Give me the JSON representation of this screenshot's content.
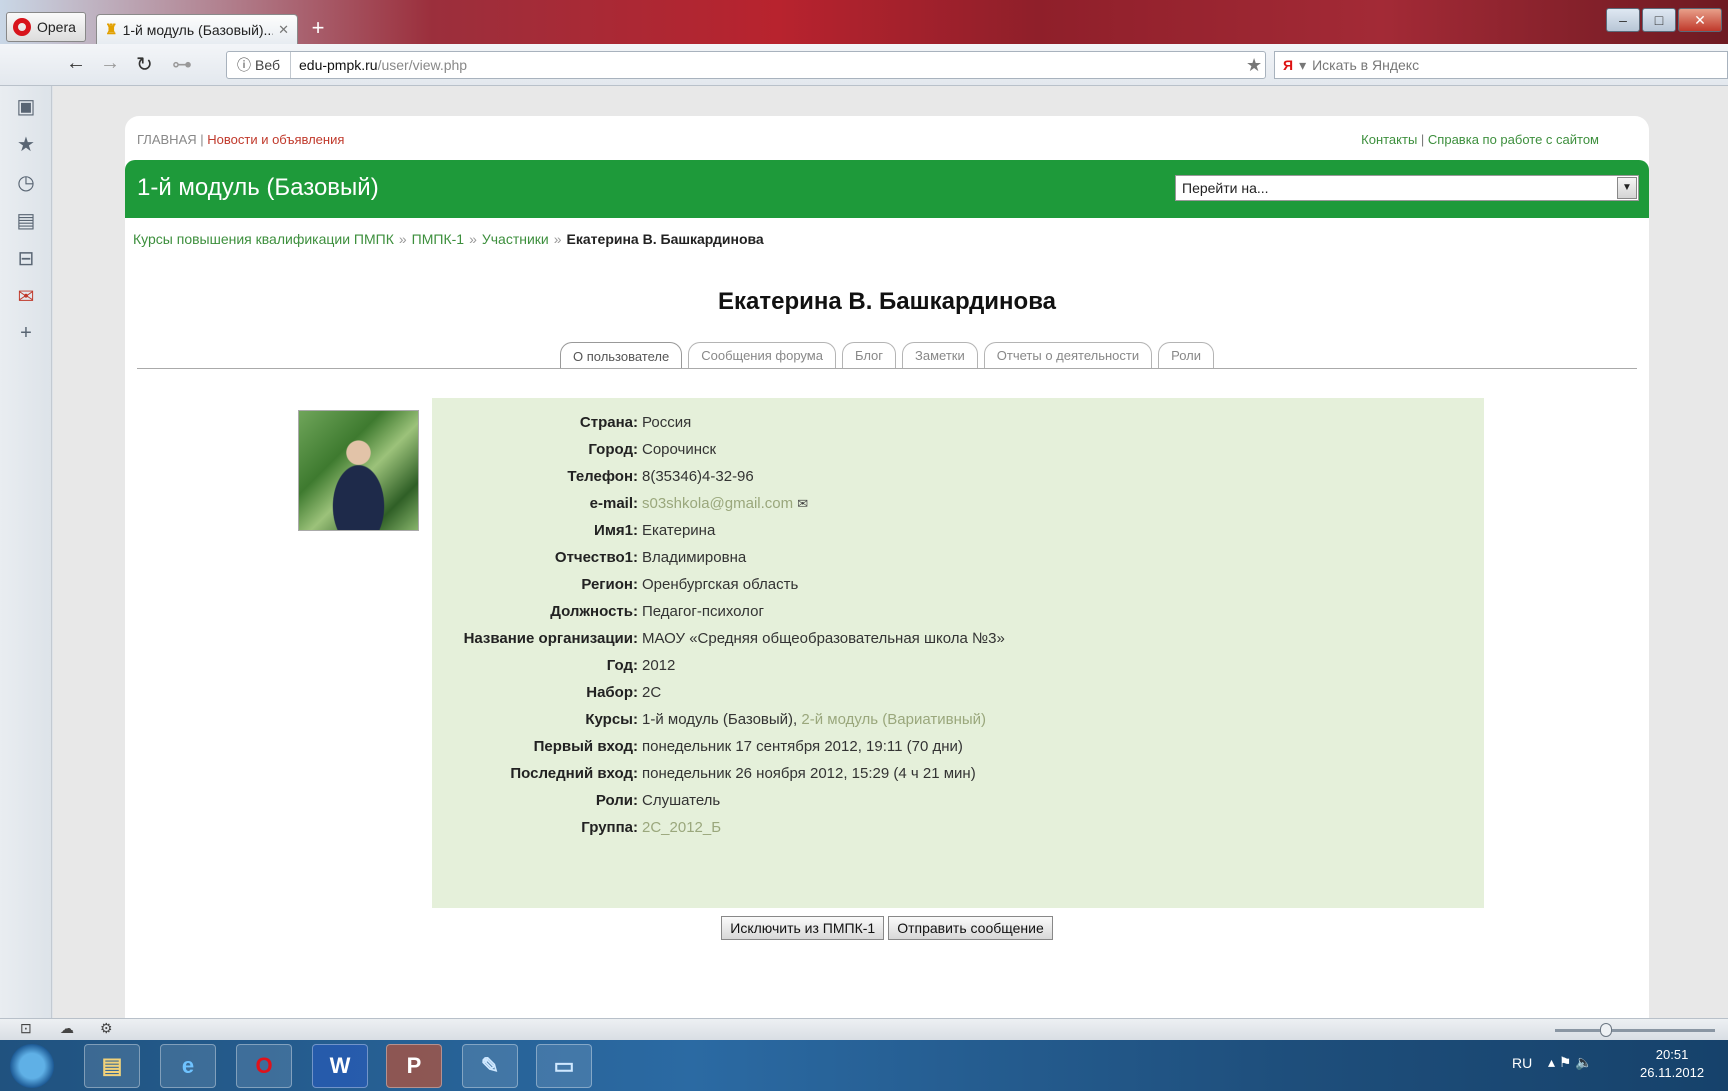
{
  "browser": {
    "menu_label": "Opera",
    "tab_title": "1-й модуль (Базовый)...",
    "address_prefix": "Веб",
    "url_host": "edu-pmpk.ru",
    "url_path": "/user/view.php",
    "search_placeholder": "Искать в Яндекс"
  },
  "site": {
    "top_left_home": "ГЛАВНАЯ",
    "top_left_news": "Новости и объявления",
    "top_right_contacts": "Контакты",
    "top_right_help": "Справка по работе с сайтом",
    "course_title": "1-й модуль (Базовый)",
    "jump_placeholder": "Перейти на..."
  },
  "breadcrumb": {
    "items": [
      "Курсы повышения квалификации ПМПК",
      "ПМПК-1",
      "Участники"
    ],
    "current": "Екатерина В. Башкардинова"
  },
  "user": {
    "full_name": "Екатерина В. Башкардинова"
  },
  "tabs": [
    "О пользователе",
    "Сообщения форума",
    "Блог",
    "Заметки",
    "Отчеты о деятельности",
    "Роли"
  ],
  "profile": {
    "country": {
      "label": "Страна:",
      "value": "Россия"
    },
    "city": {
      "label": "Город:",
      "value": "Сорочинск"
    },
    "phone": {
      "label": "Телефон:",
      "value": "8(35346)4-32-96"
    },
    "email": {
      "label": "e-mail:",
      "value": "s03shkola@gmail.com"
    },
    "name1": {
      "label": "Имя1:",
      "value": "Екатерина"
    },
    "patronymic": {
      "label": "Отчество1:",
      "value": "Владимировна"
    },
    "region": {
      "label": "Регион:",
      "value": "Оренбургская область"
    },
    "position": {
      "label": "Должность:",
      "value": "Педагог-психолог"
    },
    "organization": {
      "label": "Название организации:",
      "value": "МАОУ «Средняя общеобразовательная школа №3»"
    },
    "year": {
      "label": "Год:",
      "value": "2012"
    },
    "intake": {
      "label": "Набор:",
      "value": "2С"
    },
    "courses": {
      "label": "Курсы:",
      "value_current": "1-й модуль (Базовый),",
      "value_link": "2-й модуль (Вариативный)"
    },
    "first_access": {
      "label": "Первый вход:",
      "value": "понедельник 17 сентября 2012, 19:11  (70 дни)"
    },
    "last_access": {
      "label": "Последний вход:",
      "value": "понедельник 26 ноября 2012, 15:29  (4 ч 21 мин)"
    },
    "roles": {
      "label": "Роли:",
      "value": "Слушатель"
    },
    "group": {
      "label": "Группа:",
      "value": "2С_2012_Б"
    }
  },
  "actions": {
    "unenrol": "Исключить из ПМПК-1",
    "send_message": "Отправить сообщение"
  },
  "taskbar": {
    "lang": "RU",
    "time": "20:51",
    "date": "26.11.2012"
  }
}
